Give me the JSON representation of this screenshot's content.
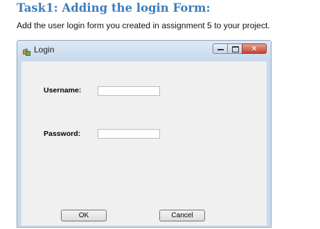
{
  "document": {
    "heading": "Task1: Adding the login Form:",
    "description": "Add the user login form you created in assignment 5 to your project."
  },
  "login_window": {
    "title": "Login",
    "icon": "form-app-icon",
    "caption_buttons": {
      "minimize": "minimize-icon",
      "maximize": "maximize-icon",
      "close": "close-icon"
    },
    "username_label": "Username:",
    "username_value": "",
    "password_label": "Password:",
    "password_value": "",
    "ok_label": "OK",
    "cancel_label": "Cancel"
  },
  "colors": {
    "heading": "#3b7dbb",
    "window_frame": "#c9dcef",
    "form_background": "#f0f0f0",
    "close_button": "#c6442e"
  }
}
